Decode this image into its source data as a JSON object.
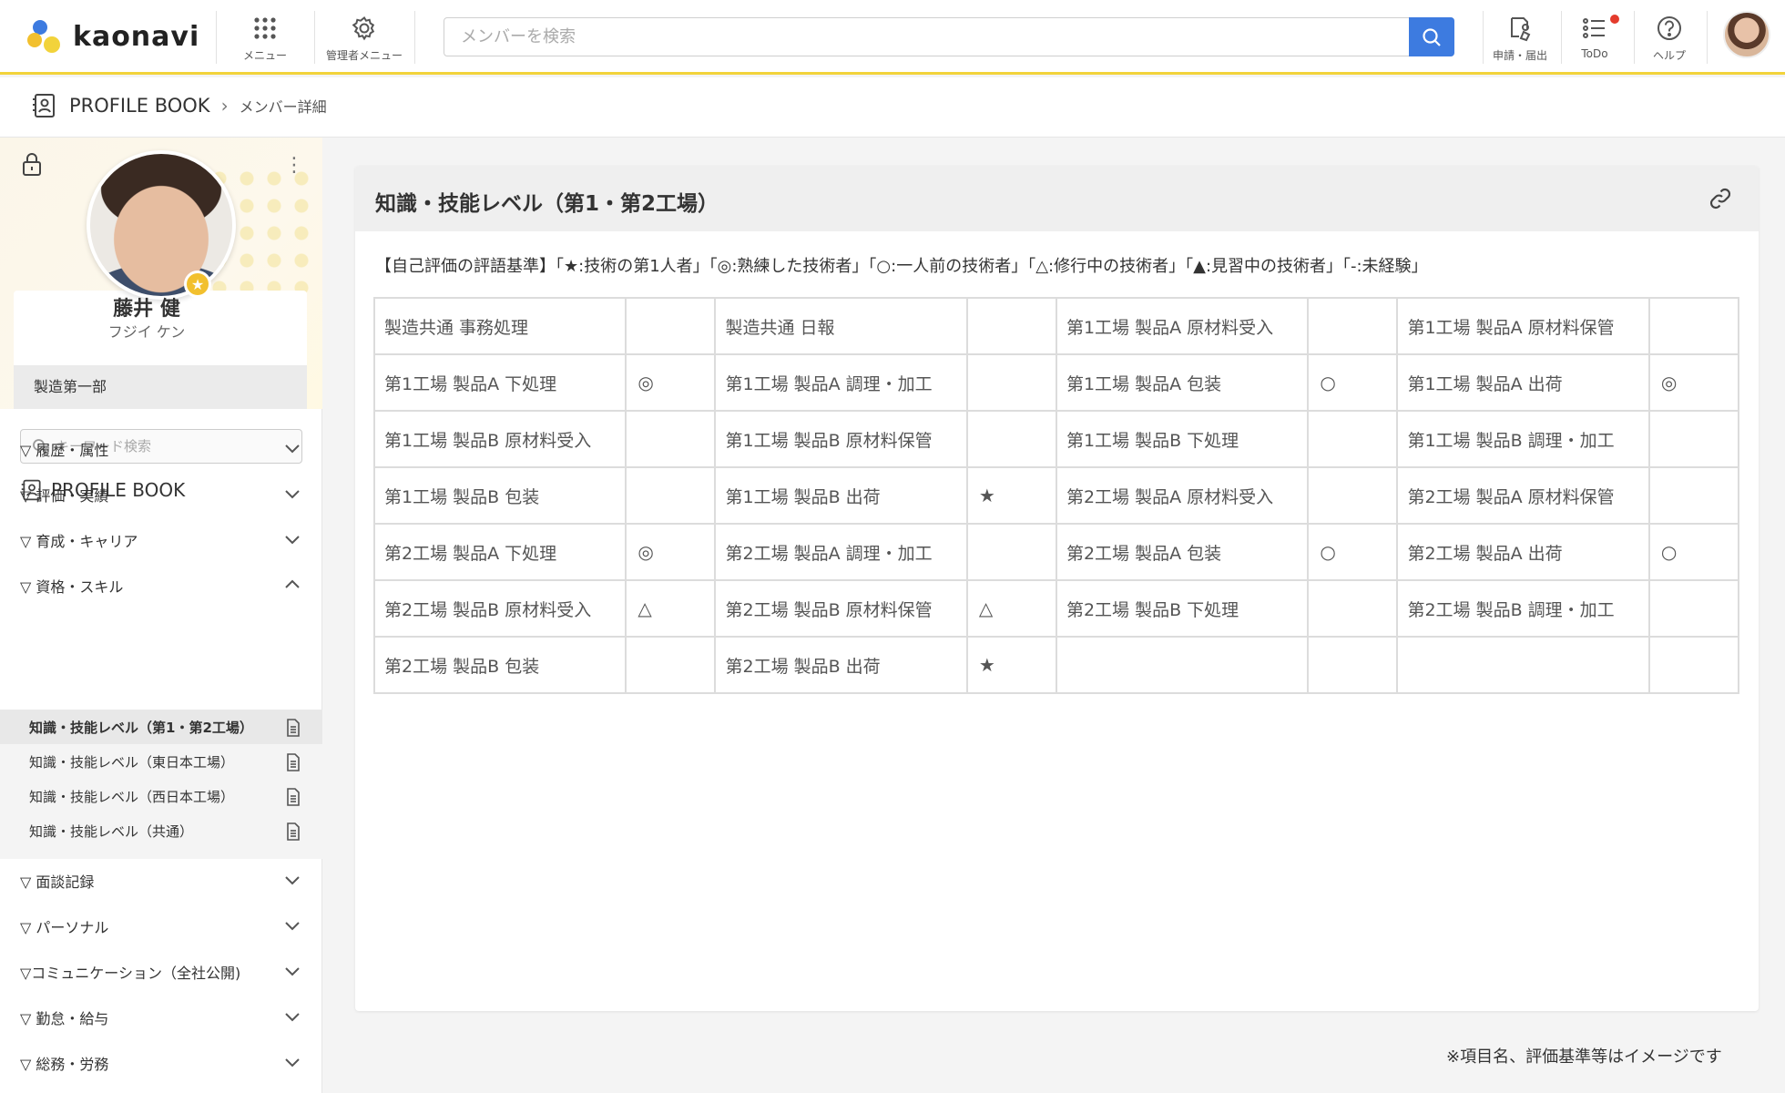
{
  "app": {
    "logo_text": "kaonavi",
    "brand_color": "#f2d33b",
    "accent_color": "#3d7be0",
    "badge_color": "#e43b2c"
  },
  "header": {
    "menu_label": "メニュー",
    "admin_menu_label": "管理者メニュー",
    "search_placeholder": "メンバーを検索",
    "requests_label": "申請・届出",
    "todo_label": "ToDo",
    "help_label": "ヘルプ"
  },
  "breadcrumb": {
    "root": "PROFILE BOOK",
    "current": "メンバー詳細"
  },
  "profile": {
    "name": "藤井 健",
    "kana": "フジイ ケン",
    "department": "製造第一部"
  },
  "sidebar": {
    "keyword_placeholder": "キーワード検索",
    "book_title": "PROFILE BOOK",
    "sections_top": [
      {
        "label": "▽ 履歴・属性"
      },
      {
        "label": "▽ 評価・実績"
      },
      {
        "label": "▽ 育成・キャリア"
      },
      {
        "label": "▽ 資格・スキル"
      }
    ],
    "sub_items": [
      {
        "label": "知識・技能レベル（第1・第2工場）"
      },
      {
        "label": "知識・技能レベル（東日本工場）"
      },
      {
        "label": "知識・技能レベル（西日本工場）"
      },
      {
        "label": "知識・技能レベル（共通）"
      }
    ],
    "sections_bottom": [
      {
        "label": "▽ 面談記録"
      },
      {
        "label": "▽ パーソナル"
      },
      {
        "label": "▽コミュニケーション（全社公開)"
      },
      {
        "label": "▽ 勤怠・給与"
      },
      {
        "label": "▽ 総務・労務"
      }
    ]
  },
  "main": {
    "title": "知識・技能レベル（第1・第2工場）",
    "legend": "【自己評価の評語基準】「★:技術の第1人者」「◎:熟練した技術者」「○:一人前の技術者」「△:修行中の技術者」「▲:見習中の技術者」「-:未経験」",
    "rows": [
      [
        {
          "name": "製造共通 事務処理",
          "mark": ""
        },
        {
          "name": "製造共通 日報",
          "mark": ""
        },
        {
          "name": "第1工場 製品A 原材料受入",
          "mark": ""
        },
        {
          "name": "第1工場 製品A 原材料保管",
          "mark": ""
        }
      ],
      [
        {
          "name": "第1工場 製品A 下処理",
          "mark": "◎"
        },
        {
          "name": "第1工場 製品A 調理・加工",
          "mark": ""
        },
        {
          "name": "第1工場 製品A 包装",
          "mark": "○"
        },
        {
          "name": "第1工場 製品A 出荷",
          "mark": "◎"
        }
      ],
      [
        {
          "name": "第1工場 製品B 原材料受入",
          "mark": ""
        },
        {
          "name": "第1工場 製品B 原材料保管",
          "mark": ""
        },
        {
          "name": "第1工場 製品B 下処理",
          "mark": ""
        },
        {
          "name": "第1工場 製品B 調理・加工",
          "mark": ""
        }
      ],
      [
        {
          "name": "第1工場 製品B 包装",
          "mark": ""
        },
        {
          "name": "第1工場 製品B 出荷",
          "mark": "★"
        },
        {
          "name": "第2工場 製品A 原材料受入",
          "mark": ""
        },
        {
          "name": "第2工場 製品A 原材料保管",
          "mark": ""
        }
      ],
      [
        {
          "name": "第2工場 製品A 下処理",
          "mark": "◎"
        },
        {
          "name": "第2工場 製品A 調理・加工",
          "mark": ""
        },
        {
          "name": "第2工場 製品A 包装",
          "mark": "○"
        },
        {
          "name": "第2工場 製品A 出荷",
          "mark": "○"
        }
      ],
      [
        {
          "name": "第2工場 製品B 原材料受入",
          "mark": "△"
        },
        {
          "name": "第2工場 製品B 原材料保管",
          "mark": "△"
        },
        {
          "name": "第2工場 製品B 下処理",
          "mark": ""
        },
        {
          "name": "第2工場 製品B 調理・加工",
          "mark": ""
        }
      ],
      [
        {
          "name": "第2工場 製品B 包装",
          "mark": ""
        },
        {
          "name": "第2工場 製品B 出荷",
          "mark": "★"
        },
        {
          "name": "",
          "mark": ""
        },
        {
          "name": "",
          "mark": ""
        }
      ]
    ]
  },
  "footer_note": "※項目名、評価基準等はイメージです"
}
